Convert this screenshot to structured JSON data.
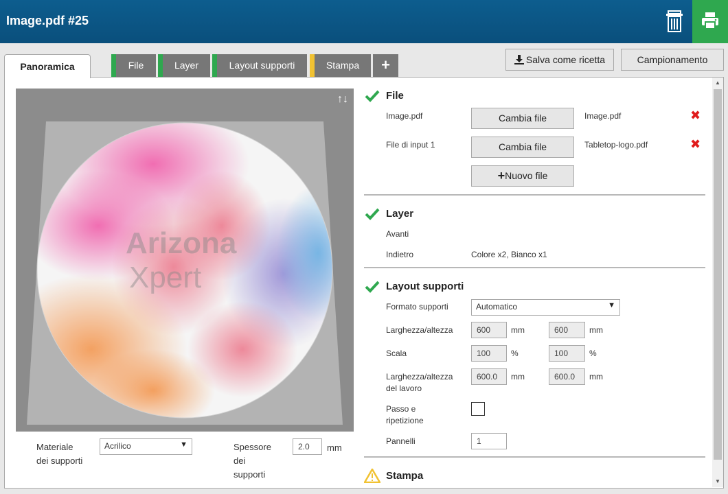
{
  "header": {
    "title": "Image.pdf #25"
  },
  "tabs": {
    "overview": "Panoramica",
    "file": "File",
    "layer": "Layer",
    "layout": "Layout supporti",
    "print": "Stampa",
    "add": "+"
  },
  "toolbar": {
    "save_recipe": "Salva come ricetta",
    "sampling": "Campionamento"
  },
  "preview": {
    "watermark_line1": "Arizona",
    "watermark_line2": "Xpert",
    "arrows": "↑↓"
  },
  "media_form": {
    "material_label_1": "Materiale",
    "material_label_2": "dei supporti",
    "material_value": "Acrilico",
    "thickness_label_1": "Spessore",
    "thickness_label_2": "dei",
    "thickness_label_3": "supporti",
    "thickness_value": "2.0",
    "thickness_unit": "mm"
  },
  "file_section": {
    "title": "File",
    "rows": [
      {
        "label": "Image.pdf",
        "button": "Cambia file",
        "filename": "Image.pdf"
      },
      {
        "label": "File di input 1",
        "button": "Cambia file",
        "filename": "Tabletop-logo.pdf"
      }
    ],
    "new_file": "Nuovo file"
  },
  "layer_section": {
    "title": "Layer",
    "front_label": "Avanti",
    "back_label": "Indietro",
    "back_value": "Colore x2, Bianco x1"
  },
  "layout_section": {
    "title": "Layout supporti",
    "format_label": "Formato supporti",
    "format_value": "Automatico",
    "size_label": "Larghezza/altezza",
    "width": "600",
    "height": "600",
    "size_unit": "mm",
    "scale_label": "Scala",
    "scale_x": "100",
    "scale_y": "100",
    "scale_unit": "%",
    "job_size_label_1": "Larghezza/altezza",
    "job_size_label_2": "del lavoro",
    "job_width": "600.0",
    "job_height": "600.0",
    "job_unit": "mm",
    "step_label_1": "Passo e",
    "step_label_2": "ripetizione",
    "panels_label": "Pannelli",
    "panels_value": "1"
  },
  "print_section": {
    "title": "Stampa"
  },
  "colors": {
    "header": "#0a4f7c",
    "print_green": "#2fa84f",
    "warning_yellow": "#f1c232",
    "error_red": "#e01b1b"
  }
}
